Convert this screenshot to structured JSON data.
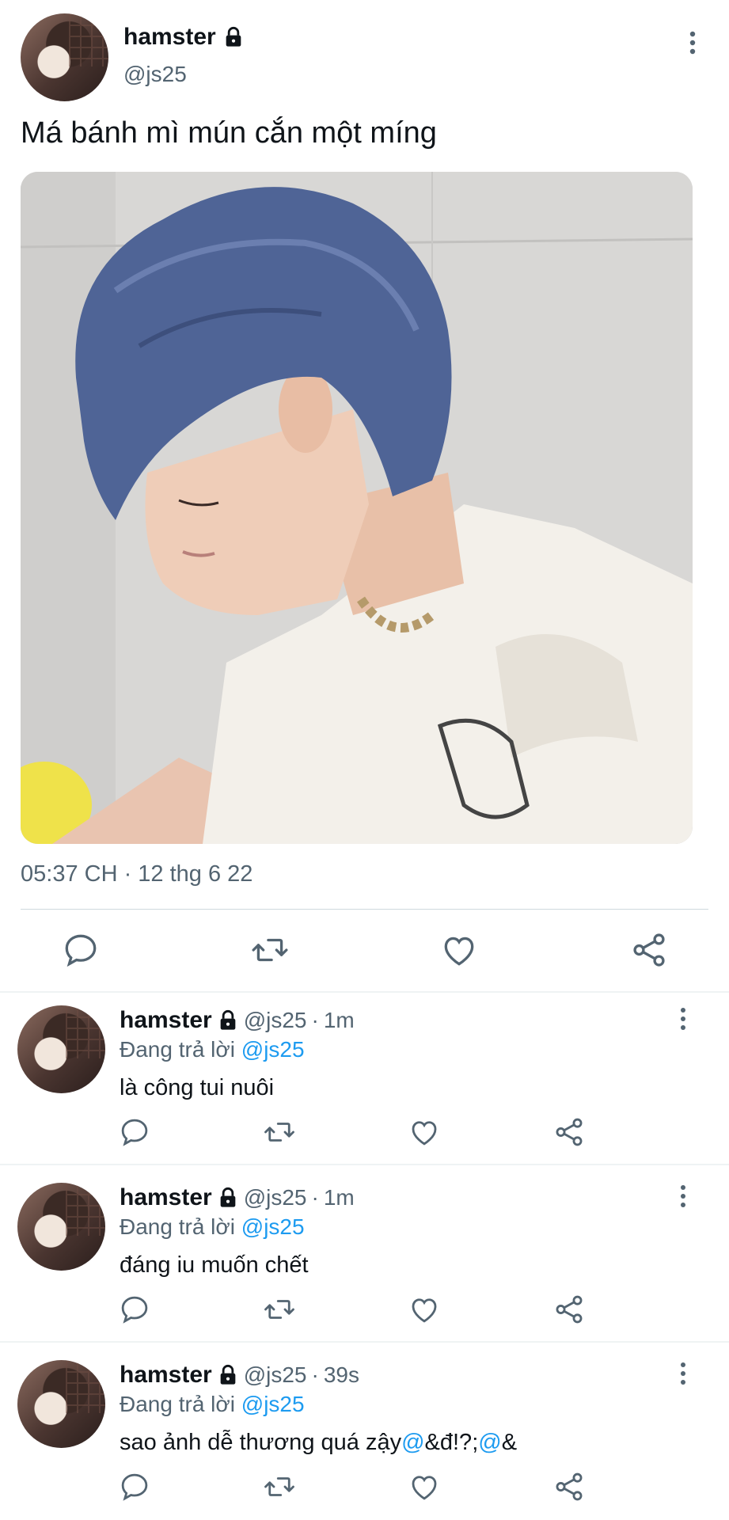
{
  "tweet": {
    "author_name": "hamster",
    "handle": "@js25",
    "text": "Má bánh mì mún cắn một míng",
    "timestamp": "05:37 CH · 12 thg 6 22",
    "icons": [
      "lock-icon",
      "more-icon",
      "reply-icon",
      "retweet-icon",
      "like-icon",
      "share-icon"
    ]
  },
  "replies": [
    {
      "author_name": "hamster",
      "handle": "@js25",
      "time": "1m",
      "replying_label": "Đang trả lời",
      "replying_to": "@js25",
      "text_parts": [
        "là công tui nuôi",
        "",
        "",
        "",
        ""
      ]
    },
    {
      "author_name": "hamster",
      "handle": "@js25",
      "time": "1m",
      "replying_label": "Đang trả lời",
      "replying_to": "@js25",
      "text_parts": [
        "đáng iu muốn chết",
        "",
        "",
        "",
        ""
      ]
    },
    {
      "author_name": "hamster",
      "handle": "@js25",
      "time": "39s",
      "replying_label": "Đang trả lời",
      "replying_to": "@js25",
      "text_parts": [
        "sao ảnh dễ thương quá zậy",
        "@",
        "&đ!?;",
        "@",
        "&"
      ]
    }
  ],
  "colors": {
    "link": "#1d9bf0",
    "secondary_text": "#536471",
    "primary_text": "#0f1419",
    "divider": "#eff3f4"
  }
}
